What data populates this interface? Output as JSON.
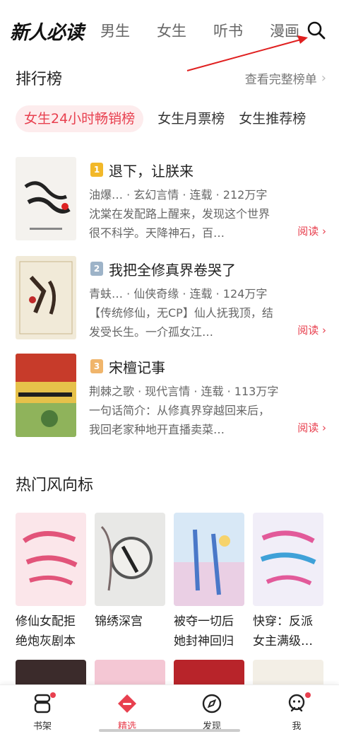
{
  "header": {
    "logo": "新人必读",
    "channels": [
      "男生",
      "女生",
      "听书",
      "漫画"
    ]
  },
  "ranking": {
    "title": "排行榜",
    "more": "查看完整榜单",
    "tabs": [
      "女生24小时畅销榜",
      "女生月票榜",
      "女生推荐榜"
    ],
    "books": [
      {
        "rank": "1",
        "title": "退下，让朕来",
        "meta": "油爆…  ·  玄幻言情  ·  连载  ·  212万字",
        "desc": "沈棠在发配路上醒来，发现这个世界很不科学。天降神石，百…",
        "read": "阅读 ›",
        "rank_color": "#f2b829"
      },
      {
        "rank": "2",
        "title": "我把全修真界卷哭了",
        "meta": "青蚨…  ·  仙侠奇缘  ·  连载  ·  124万字",
        "desc": "【传统修仙，无CP】仙人抚我顶，结发受长生。一介孤女江…",
        "read": "阅读 ›",
        "rank_color": "#9db3c8"
      },
      {
        "rank": "3",
        "title": "宋檀记事",
        "meta": "荆棘之歌 · 现代言情  ·  连载  ·  113万字",
        "desc": "一句话简介：从修真界穿越回来后，我回老家种地开直播卖菜…",
        "read": "阅读 ›",
        "rank_color": "#f0b56b"
      }
    ]
  },
  "trending": {
    "title": "热门风向标",
    "items": [
      {
        "title": "修仙女配拒绝炮灰剧本"
      },
      {
        "title": "锦绣深宫"
      },
      {
        "title": "被夺一切后她封神回归"
      },
      {
        "title": "快穿：反派女主满级…"
      }
    ]
  },
  "tabbar": {
    "items": [
      "书架",
      "精选",
      "发现",
      "我"
    ]
  },
  "colors": {
    "accent": "#e8404f",
    "annotation_arrow": "#e02020"
  },
  "icons": [
    "search-icon",
    "bookshelf-icon",
    "featured-icon",
    "discover-icon",
    "profile-icon",
    "chevron-right-icon"
  ]
}
